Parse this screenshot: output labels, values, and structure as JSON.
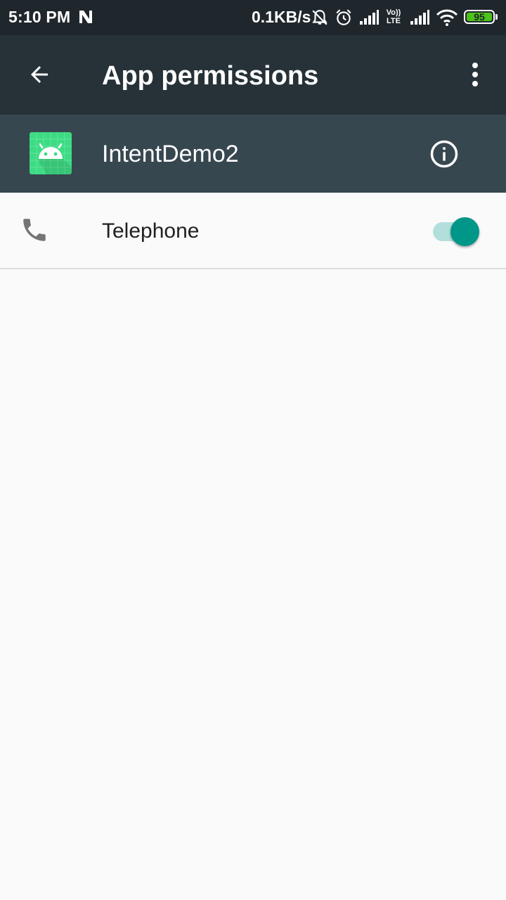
{
  "status_bar": {
    "time": "5:10 PM",
    "network_speed": "0.1KB/s",
    "volte_top": "Vo))",
    "volte_bottom": "LTE",
    "battery_level": "95",
    "icons": [
      "notification-n-icon",
      "bell-muted-icon",
      "alarm-icon",
      "signal-icon",
      "volte-icon",
      "signal-icon",
      "wifi-icon",
      "battery-icon"
    ]
  },
  "toolbar": {
    "title": "App permissions",
    "back_icon": "arrow-back-icon",
    "overflow_icon": "more-vertical-icon"
  },
  "app_header": {
    "app_name": "IntentDemo2",
    "app_icon": "android-icon",
    "info_icon": "info-icon"
  },
  "permissions": [
    {
      "label": "Telephone",
      "icon": "phone-icon",
      "enabled": true
    }
  ],
  "colors": {
    "status_bar": "#1f262c",
    "toolbar": "#263238",
    "app_header": "#37474f",
    "accent": "#009688",
    "switch_track": "#b2dfdb",
    "background": "#fafafa",
    "battery": "#4cc21a"
  }
}
